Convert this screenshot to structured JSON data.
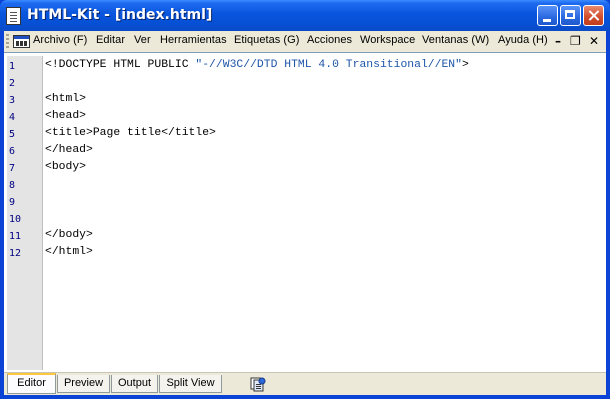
{
  "window": {
    "title": "HTML-Kit - [index.html]"
  },
  "menubar": {
    "items": [
      {
        "label": "Archivo (F)"
      },
      {
        "label": "Editar"
      },
      {
        "label": "Ver"
      },
      {
        "label": "Herramientas"
      },
      {
        "label": "Etiquetas (G)"
      },
      {
        "label": "Acciones"
      },
      {
        "label": "Workspace"
      },
      {
        "label": "Ventanas (W)"
      },
      {
        "label": "Ayuda (H)"
      }
    ],
    "mdi_minimize": "–",
    "mdi_restore": "❐",
    "mdi_close": "✕"
  },
  "editor": {
    "line_numbers": [
      "1",
      "2",
      "3",
      "4",
      "5",
      "6",
      "7",
      "8",
      "9",
      "10",
      "11",
      "12"
    ],
    "lines": [
      {
        "tag": "<!DOCTYPE HTML PUBLIC ",
        "str": "\"-//W3C//DTD HTML 4.0 Transitional//EN\"",
        "tail": ">"
      },
      {
        "tag": "",
        "str": "",
        "tail": ""
      },
      {
        "tag": "<html>",
        "str": "",
        "tail": ""
      },
      {
        "tag": "<head>",
        "str": "",
        "tail": ""
      },
      {
        "tag": "<title>Page title</title>",
        "str": "",
        "tail": ""
      },
      {
        "tag": "</head>",
        "str": "",
        "tail": ""
      },
      {
        "tag": "<body>",
        "str": "",
        "tail": ""
      },
      {
        "tag": "",
        "str": "",
        "tail": ""
      },
      {
        "tag": "",
        "str": "",
        "tail": ""
      },
      {
        "tag": "",
        "str": "",
        "tail": ""
      },
      {
        "tag": "</body>",
        "str": "",
        "tail": ""
      },
      {
        "tag": "</html>",
        "str": "",
        "tail": ""
      }
    ]
  },
  "tabs": {
    "items": [
      {
        "label": "Editor",
        "active": true
      },
      {
        "label": "Preview",
        "active": false
      },
      {
        "label": "Output",
        "active": false
      },
      {
        "label": "Split View",
        "active": false
      }
    ]
  },
  "icons": {
    "app": "document-icon",
    "menu_doc": "html-document-icon",
    "tab_extra": "pages-gear-icon"
  },
  "colors": {
    "titlebar": "#0855dd",
    "chrome": "#ece9d8",
    "gutter": "#e4e4e4",
    "string": "#1d54a8",
    "line_number": "#000080",
    "active_tab_accent": "#ffc83c"
  }
}
